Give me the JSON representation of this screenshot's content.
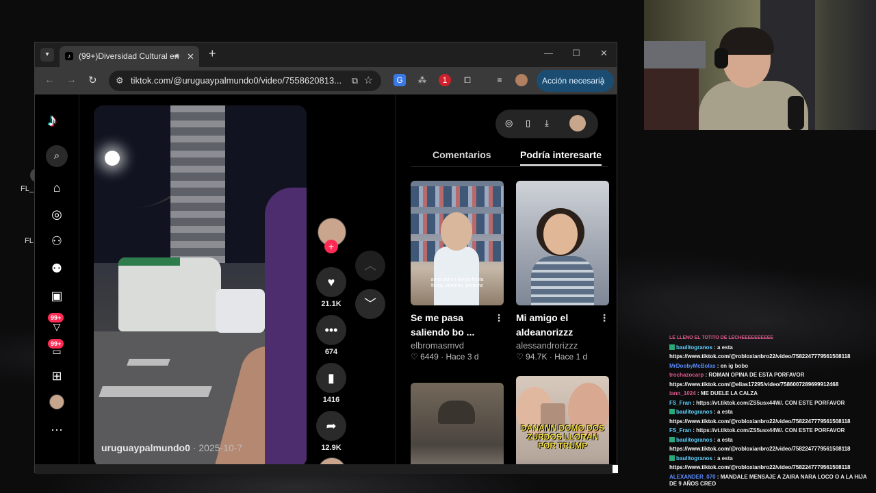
{
  "desktop": {
    "icon1_label": "FL_",
    "icon2_label": "FL"
  },
  "browser": {
    "tab": {
      "title": "(99+)Diversidad Cultural en",
      "favicon": "tiktok-icon",
      "audio_icon": "speaker-icon"
    },
    "url": "tiktok.com/@uruguaypalmundo0/video/7558620813...",
    "action_button": "Acción necesaria",
    "extension_badge": "1"
  },
  "sidebar": {
    "badges": [
      "99+",
      "99+"
    ]
  },
  "video": {
    "author": "uruguaypalmundo0",
    "date": "· 2025-10-7"
  },
  "actions": {
    "likes": "21.1K",
    "comments": "674",
    "saves": "1416",
    "shares": "12.9K"
  },
  "panel": {
    "tabs": [
      "Comentarios",
      "Podría interesarte"
    ],
    "active_tab": "Podría interesarte",
    "cards": [
      {
        "title_l1": "Se me pasa",
        "title_l2": "saliendo bo ...",
        "author": "elbromasmvd",
        "meta": "6449 · Hace 3 d",
        "caption": "anda ladrón dando fiesta fiesta, perdone, perdone"
      },
      {
        "title_l1": "Mi amigo el",
        "title_l2": "aldeanorizzz",
        "author": "alessandrorizzz",
        "meta": "94.7K · Hace 1 d"
      },
      {
        "title_l1": "",
        "title_l2": "",
        "author": "",
        "meta": ""
      },
      {
        "overlay": "DANANN DOMO DOS ZURDOS LLORAN POR TRUMP"
      }
    ]
  },
  "chat": {
    "messages": [
      {
        "user": "",
        "text": "LE LLENO EL TOTITO DE LECHEEEEEEEEEE",
        "color": "#e05a8c"
      },
      {
        "user": "baulitogranos",
        "text": ": a esta",
        "color": "#5fd3ff"
      },
      {
        "user": "",
        "text": "https://www.tiktok.com/@robloxianbro22/video/7582247779561508118",
        "color": "#ffffff"
      },
      {
        "user": "MrDoobyMcBolas",
        "text": ": en ig bobo",
        "color": "#5b8cff"
      },
      {
        "user": "trochazocarp",
        "text": ": ROMAN OPINA DE ESTA PORFAVOR",
        "color": "#e05a8c"
      },
      {
        "user": "",
        "text": "https://www.tiktok.com/@elias17295/video/7586007289699912468",
        "color": "#ffffff"
      },
      {
        "user": "iann_1024",
        "text": ": ME DUELE LA CALZA",
        "color": "#e05a8c"
      },
      {
        "user": "FS_Fran",
        "text": ": https://vt.tiktok.com/ZS5usx44W/. CON ESTE PORFAVOR",
        "color": "#5fd3ff"
      },
      {
        "user": "baulitogranos",
        "text": ": a esta",
        "color": "#5fd3ff"
      },
      {
        "user": "",
        "text": "https://www.tiktok.com/@robloxianbro22/video/7582247779561508118",
        "color": "#ffffff"
      },
      {
        "user": "FS_Fran",
        "text": ": https://vt.tiktok.com/ZS5usx44W/. CON ESTE PORFAVOR",
        "color": "#5fd3ff"
      },
      {
        "user": "baulitogranos",
        "text": ": a esta",
        "color": "#5fd3ff"
      },
      {
        "user": "",
        "text": "https://www.tiktok.com/@robloxianbro22/video/7582247779561508118",
        "color": "#ffffff"
      },
      {
        "user": "baulitogranos",
        "text": ": a esta",
        "color": "#5fd3ff"
      },
      {
        "user": "",
        "text": "https://www.tiktok.com/@robloxianbro22/video/7582247779561508118",
        "color": "#ffffff"
      },
      {
        "user": "ALEXANDER_070",
        "text": ": MANDALE MENSAJE A ZAIRA NARA LOCO O A LA HIJA DE 9 AÑOS CREO",
        "color": "#5b8cff"
      }
    ]
  },
  "colors": {
    "tiktok_red": "#fe2c55",
    "tiktok_cyan": "#25f4ee",
    "action_blue": "#1b4d73"
  }
}
